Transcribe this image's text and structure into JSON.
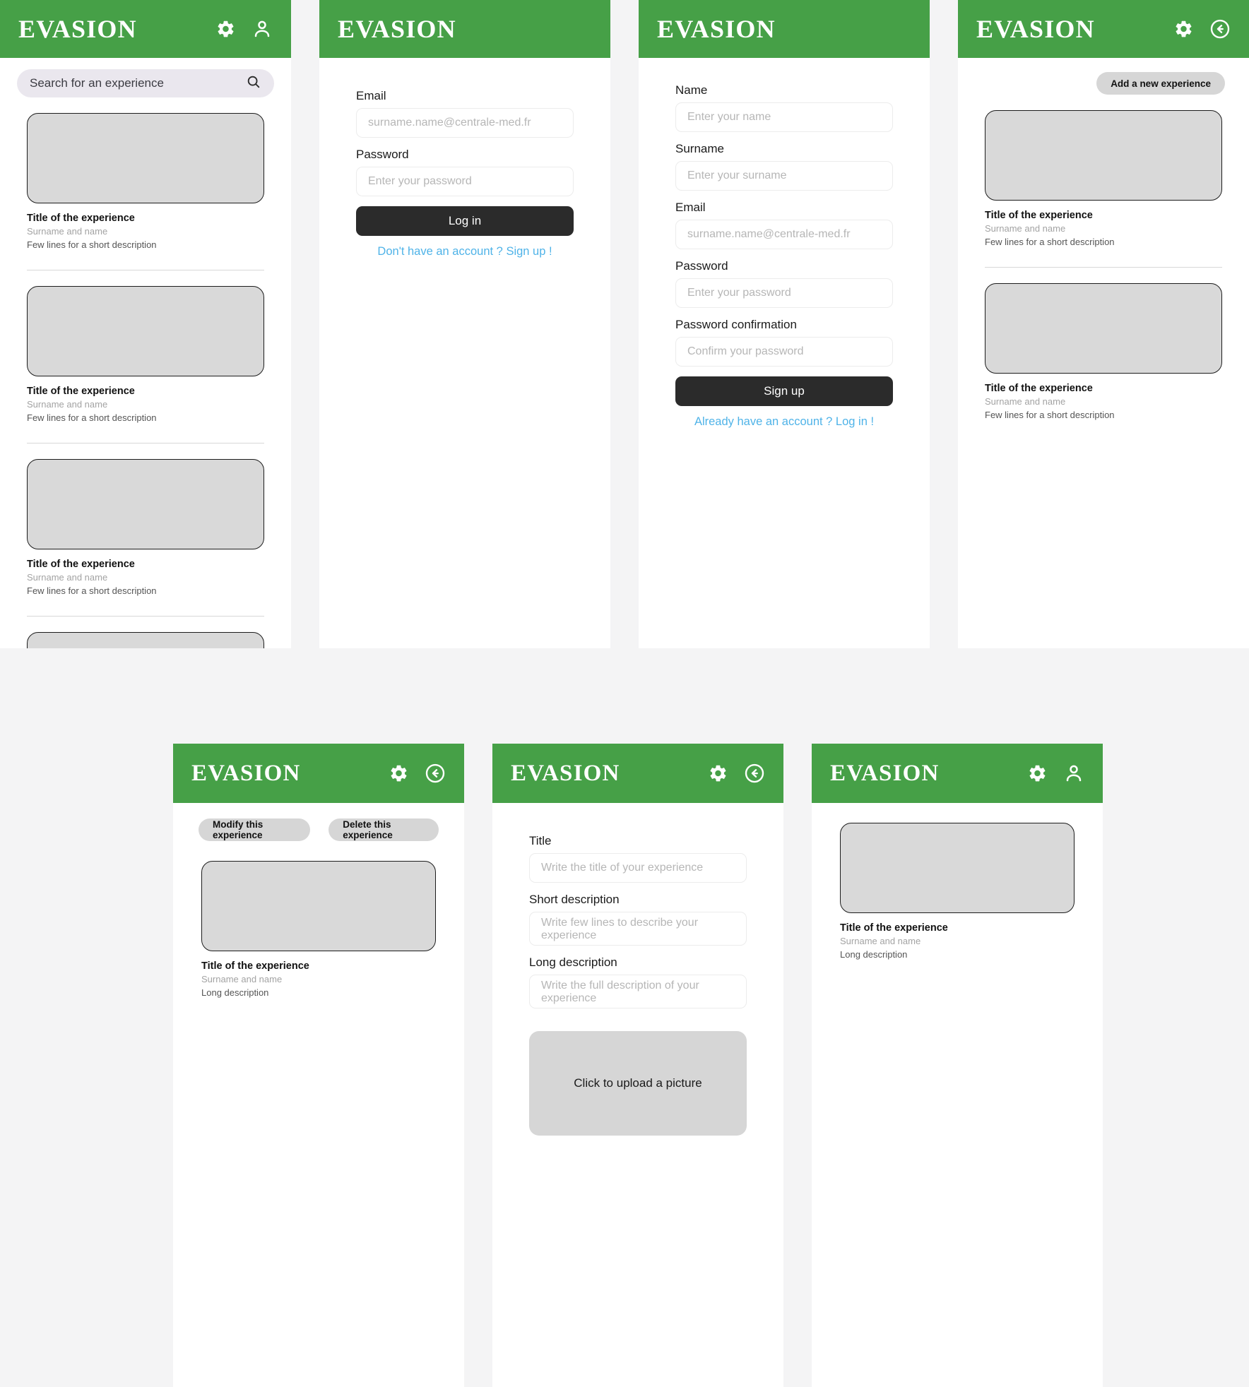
{
  "brand": "EVASION",
  "theme": {
    "green": "#46a047",
    "dark_button": "#2b2b2b",
    "link_blue": "#4fb3e8",
    "pill_gray": "#d6d6d6",
    "thumb_gray": "#d9d9d9",
    "search_bg": "#eae7ee",
    "page_bg": "#f4f4f5"
  },
  "icons": {
    "gear": "gear-icon",
    "person": "person-icon",
    "back": "back-arrow-icon",
    "search": "search-icon"
  },
  "screens": {
    "home": {
      "name": "home-feed",
      "search_placeholder": "Search for an experience",
      "experiences": [
        {
          "title": "Title of the experience",
          "author": "Surname and name",
          "description": "Few lines for a short description"
        },
        {
          "title": "Title of the experience",
          "author": "Surname and name",
          "description": "Few lines for a short description"
        },
        {
          "title": "Title of the experience",
          "author": "Surname and name",
          "description": "Few lines for a short description"
        }
      ]
    },
    "login": {
      "name": "login",
      "fields": [
        {
          "label": "Email",
          "placeholder": "surname.name@centrale-med.fr"
        },
        {
          "label": "Password",
          "placeholder": "Enter your password"
        }
      ],
      "submit_label": "Log in",
      "switch_link": "Don't have an account ? Sign up !"
    },
    "signup": {
      "name": "signup",
      "fields": [
        {
          "label": "Name",
          "placeholder": "Enter your name"
        },
        {
          "label": "Surname",
          "placeholder": "Enter your surname"
        },
        {
          "label": "Email",
          "placeholder": "surname.name@centrale-med.fr"
        },
        {
          "label": "Password",
          "placeholder": "Enter your password"
        },
        {
          "label": "Password confirmation",
          "placeholder": "Confirm your password"
        }
      ],
      "submit_label": "Sign up",
      "switch_link": "Already have an account ? Log in !"
    },
    "my_experiences": {
      "name": "my-experiences",
      "add_button": "Add a new experience",
      "experiences": [
        {
          "title": "Title of the experience",
          "author": "Surname and name",
          "description": "Few lines for a short description"
        },
        {
          "title": "Title of the experience",
          "author": "Surname and name",
          "description": "Few lines for a short description"
        }
      ]
    },
    "experience_admin": {
      "name": "experience-detail-admin",
      "modify_button": "Modify this experience",
      "delete_button": "Delete this experience",
      "experience": {
        "title": "Title of the experience",
        "author": "Surname and name",
        "description": "Long description"
      }
    },
    "experience_form": {
      "name": "experience-editor",
      "fields": [
        {
          "label": "Title",
          "placeholder": "Write the title of your experience"
        },
        {
          "label": "Short description",
          "placeholder": "Write few lines to describe your experience"
        },
        {
          "label": "Long description",
          "placeholder": "Write the full description of your experience"
        }
      ],
      "upload_label": "Click to upload a picture"
    },
    "experience_public": {
      "name": "experience-detail-public",
      "experience": {
        "title": "Title of the experience",
        "author": "Surname and name",
        "description": "Long description"
      }
    }
  }
}
